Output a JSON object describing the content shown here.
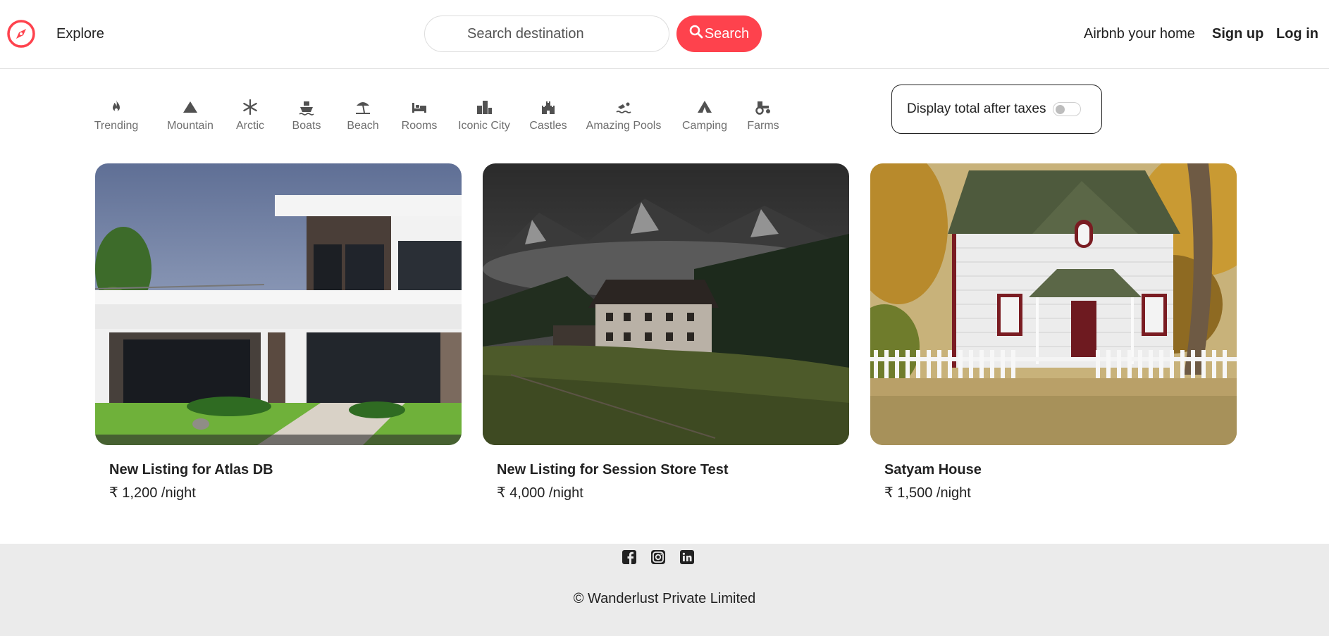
{
  "navbar": {
    "brand_icon": "compass-icon",
    "explore": "Explore",
    "search_placeholder": "Search destination",
    "search_button": "Search",
    "host_link": "Airbnb your home",
    "signup": "Sign up",
    "login": "Log in",
    "accent_color": "#fe424d"
  },
  "filters": [
    {
      "label": "Trending",
      "icon": "fire-icon"
    },
    {
      "label": "Mountain",
      "icon": "mountain-icon"
    },
    {
      "label": "Arctic",
      "icon": "snowflake-icon"
    },
    {
      "label": "Boats",
      "icon": "ship-icon"
    },
    {
      "label": "Beach",
      "icon": "umbrella-beach-icon"
    },
    {
      "label": "Rooms",
      "icon": "bed-icon"
    },
    {
      "label": "Iconic City",
      "icon": "city-icon"
    },
    {
      "label": "Castles",
      "icon": "castle-icon"
    },
    {
      "label": "Amazing Pools",
      "icon": "swimmer-icon"
    },
    {
      "label": "Camping",
      "icon": "campground-icon"
    },
    {
      "label": "Farms",
      "icon": "tractor-icon"
    }
  ],
  "tax_toggle": {
    "label": "Display total after taxes",
    "enabled": false
  },
  "listings": [
    {
      "title": "New Listing for Atlas DB",
      "price": "₹ 1,200 /night",
      "image": "modern-white-villa-photo"
    },
    {
      "title": "New Listing for Session Store Test",
      "price": "₹ 4,000 /night",
      "image": "mountain-farmhouse-photo"
    },
    {
      "title": "Satyam House",
      "price": "₹ 1,500 /night",
      "image": "white-cottage-autumn-photo"
    }
  ],
  "footer": {
    "socials": [
      "facebook-icon",
      "instagram-icon",
      "linkedin-icon"
    ],
    "copyright": "© Wanderlust Private Limited"
  }
}
